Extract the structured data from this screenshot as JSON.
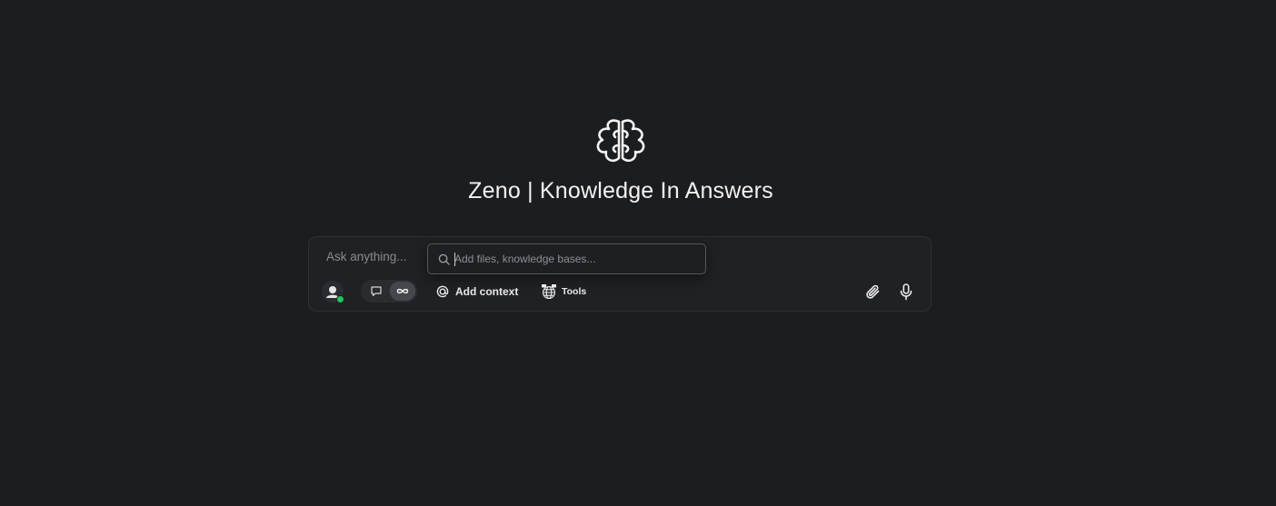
{
  "app": {
    "title": "Zeno | Knowledge In Answers",
    "logo_icon": "brain-icon"
  },
  "composer": {
    "prompt_placeholder": "Ask anything...",
    "context_search": {
      "placeholder": "Add files, knowledge bases...",
      "value": "",
      "icon": "search-icon"
    },
    "user_status": "online",
    "modes": [
      {
        "name": "chat",
        "icon": "chat-bubble-icon",
        "selected": false
      },
      {
        "name": "agent",
        "icon": "infinity-icon",
        "selected": true
      }
    ],
    "add_context_label": "Add context",
    "tools_label": "Tools",
    "actions": [
      {
        "name": "attach",
        "icon": "paperclip-icon"
      },
      {
        "name": "voice",
        "icon": "microphone-icon"
      }
    ]
  },
  "colors": {
    "background": "#1c1d1f",
    "surface": "#202124",
    "status_online": "#22c55e"
  }
}
